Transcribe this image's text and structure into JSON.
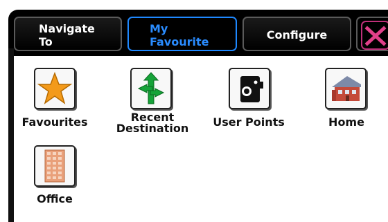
{
  "tabs": {
    "navigate": "Navigate To",
    "favourite": "My Favourite",
    "configure": "Configure"
  },
  "close_icon": "close-icon",
  "items": [
    {
      "label": "Favourites",
      "icon": "star-icon"
    },
    {
      "label": "Recent Destination",
      "icon": "route-arrows-icon"
    },
    {
      "label": "User Points",
      "icon": "speed-camera-icon"
    },
    {
      "label": "Home",
      "icon": "house-icon"
    },
    {
      "label": "Office",
      "icon": "office-building-icon"
    }
  ],
  "colors": {
    "active_tab": "#2a8cff",
    "close": "#e0408a"
  }
}
